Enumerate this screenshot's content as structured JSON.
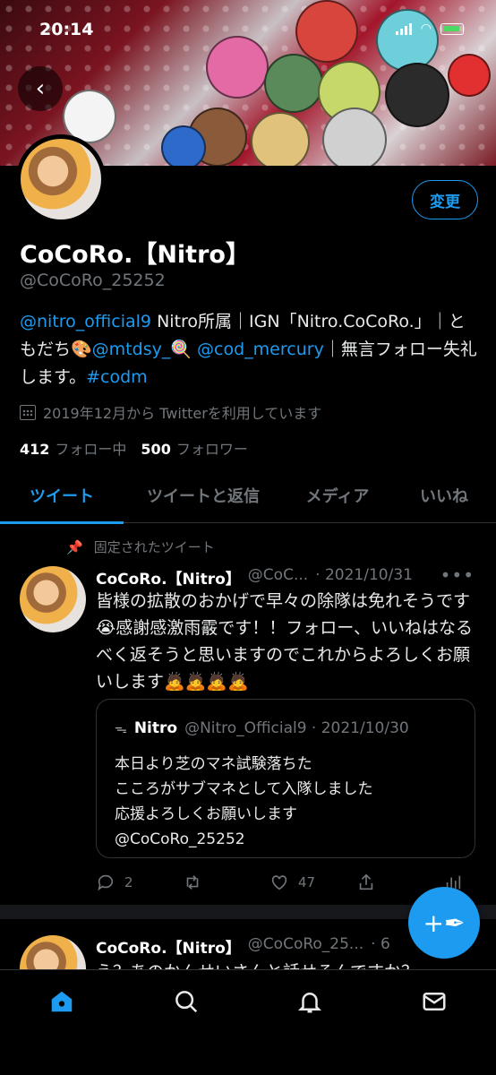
{
  "status": {
    "time": "20:14"
  },
  "profile": {
    "display_name": "CoCoRo.【Nitro】",
    "handle": "@CoCoRo_25252",
    "edit_label": "変更",
    "bio": {
      "mention_1": "@nitro_official9",
      "text_1": " Nitro所属｜IGN「Nitro.CoCoRo.」｜ともだち🎨",
      "mention_2": "@mtdsy_",
      "text_2": "🍭 ",
      "mention_3": "@cod_mercury",
      "text_3": "｜無言フォロー失礼します。",
      "hashtag": "#codm"
    },
    "joined": "2019年12月から Twitterを利用しています",
    "following_count": "412",
    "following_label": "フォロー中",
    "followers_count": "500",
    "followers_label": "フォロワー"
  },
  "tabs": [
    {
      "label": "ツイート",
      "active": true
    },
    {
      "label": "ツイートと返信",
      "active": false
    },
    {
      "label": "メディア",
      "active": false
    },
    {
      "label": "いいね",
      "active": false
    }
  ],
  "pinned_label": "固定されたツイート",
  "tweet": {
    "name": "CoCoRo.【Nitro】",
    "handle": "@CoC...",
    "date": "· 2021/10/31",
    "more": "•••",
    "text": "皆様の拡散のおかげで早々の除隊は免れそうです😭感謝感激雨霰です！！フォロー、いいねはなるべく返そうと思いますのでこれからよろしくお願いします🙇🙇🙇🙇",
    "quote": {
      "logo": "ᯓ",
      "name": "Nitro",
      "meta": "@Nitro_Official9 · 2021/10/30",
      "lines": [
        "本日より芝のマネ試験落ちた",
        "こころがサブマネとして入隊しました",
        "応援よろしくお願いします",
        "@CoCoRo_25252"
      ]
    },
    "reply_count": "2",
    "retweet_count": "",
    "like_count": "47"
  },
  "next_tweet": {
    "name": "CoCoRo.【Nitro】",
    "handle": "@CoCoRo_25...",
    "date": "· 6",
    "text": "え？あのかんせいさんと話せるんですか？"
  },
  "fab_icon": "+✒",
  "colors": {
    "accent": "#1d9bf0",
    "background": "#000000",
    "muted": "#71767b"
  }
}
